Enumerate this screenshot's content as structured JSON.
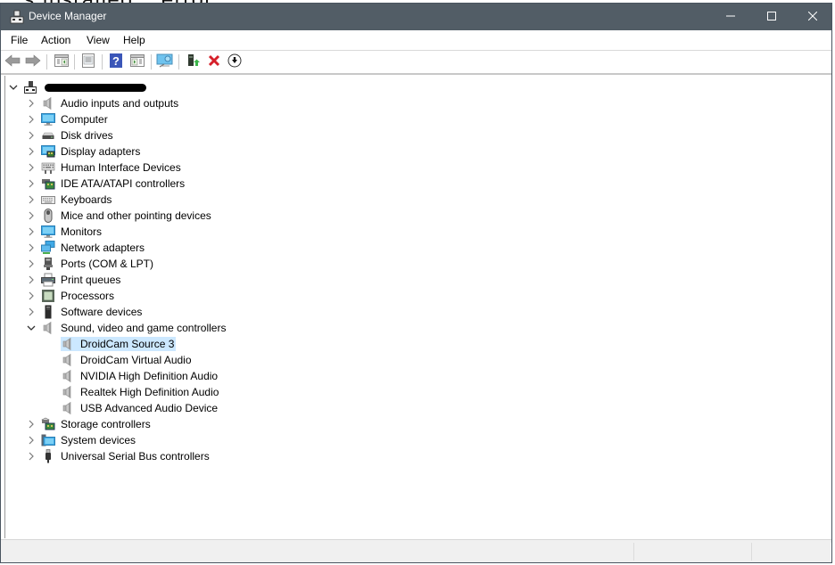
{
  "background_text": "…s installed… error",
  "window": {
    "title": "Device Manager",
    "icon": "device-manager-icon",
    "controls": {
      "minimize": "minimize-icon",
      "maximize": "maximize-icon",
      "close": "close-icon"
    }
  },
  "menu": [
    {
      "label": "File"
    },
    {
      "label": "Action"
    },
    {
      "label": "View"
    },
    {
      "label": "Help"
    }
  ],
  "toolbar": [
    {
      "name": "back",
      "icon": "arrow-left-icon"
    },
    {
      "name": "forward",
      "icon": "arrow-right-icon"
    },
    {
      "name": "show-hide-console-tree",
      "icon": "console-tree-icon"
    },
    {
      "name": "properties",
      "icon": "properties-icon"
    },
    {
      "name": "help",
      "icon": "help-icon"
    },
    {
      "name": "show-hide-action-pane",
      "icon": "action-pane-icon"
    },
    {
      "name": "scan-hardware-changes",
      "icon": "monitor-scan-icon"
    },
    {
      "name": "update-driver",
      "icon": "update-driver-icon"
    },
    {
      "name": "uninstall-device",
      "icon": "red-x-icon"
    },
    {
      "name": "disable-device",
      "icon": "down-arrow-circle-icon"
    }
  ],
  "tree": {
    "root": {
      "label": "[redacted computer name]",
      "expanded": true,
      "icon": "computer-root-icon"
    },
    "categories": [
      {
        "label": "Audio inputs and outputs",
        "icon": "speaker-icon",
        "expanded": false
      },
      {
        "label": "Computer",
        "icon": "monitor-icon",
        "expanded": false
      },
      {
        "label": "Disk drives",
        "icon": "disk-drive-icon",
        "expanded": false
      },
      {
        "label": "Display adapters",
        "icon": "display-adapter-icon",
        "expanded": false
      },
      {
        "label": "Human Interface Devices",
        "icon": "hid-icon",
        "expanded": false
      },
      {
        "label": "IDE ATA/ATAPI controllers",
        "icon": "ide-controller-icon",
        "expanded": false
      },
      {
        "label": "Keyboards",
        "icon": "keyboard-icon",
        "expanded": false
      },
      {
        "label": "Mice and other pointing devices",
        "icon": "mouse-icon",
        "expanded": false
      },
      {
        "label": "Monitors",
        "icon": "monitor-icon",
        "expanded": false
      },
      {
        "label": "Network adapters",
        "icon": "network-icon",
        "expanded": false
      },
      {
        "label": "Ports (COM & LPT)",
        "icon": "port-icon",
        "expanded": false
      },
      {
        "label": "Print queues",
        "icon": "printer-icon",
        "expanded": false
      },
      {
        "label": "Processors",
        "icon": "processor-icon",
        "expanded": false
      },
      {
        "label": "Software devices",
        "icon": "software-device-icon",
        "expanded": false
      },
      {
        "label": "Sound, video and game controllers",
        "icon": "speaker-icon",
        "expanded": true,
        "children": [
          {
            "label": "DroidCam Source 3",
            "icon": "speaker-icon",
            "selected": true
          },
          {
            "label": "DroidCam Virtual Audio",
            "icon": "speaker-icon"
          },
          {
            "label": "NVIDIA High Definition Audio",
            "icon": "speaker-icon"
          },
          {
            "label": "Realtek High Definition Audio",
            "icon": "speaker-icon"
          },
          {
            "label": "USB Advanced Audio Device",
            "icon": "speaker-icon"
          }
        ]
      },
      {
        "label": "Storage controllers",
        "icon": "storage-controller-icon",
        "expanded": false
      },
      {
        "label": "System devices",
        "icon": "system-device-icon",
        "expanded": false
      },
      {
        "label": "Universal Serial Bus controllers",
        "icon": "usb-icon",
        "expanded": false
      }
    ]
  },
  "colors": {
    "titlebar": "#525d66",
    "selection": "#cce8ff",
    "statusbar": "#f0f0f0"
  }
}
